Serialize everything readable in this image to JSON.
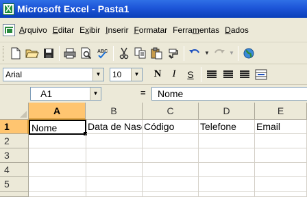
{
  "window": {
    "title": "Microsoft Excel - Pasta1"
  },
  "menu": [
    {
      "id": "arquivo",
      "label": "Arquivo"
    },
    {
      "id": "editar",
      "label": "Editar"
    },
    {
      "id": "exibir",
      "label": "Exibir"
    },
    {
      "id": "inserir",
      "label": "Inserir"
    },
    {
      "id": "formatar",
      "label": "Formatar"
    },
    {
      "id": "ferramentas",
      "label": "Ferramentas"
    },
    {
      "id": "dados",
      "label": "Dados"
    }
  ],
  "toolbar": {
    "icons": [
      "new-icon",
      "open-icon",
      "save-icon",
      "print-icon",
      "print-preview-icon",
      "spelling-icon",
      "cut-icon",
      "copy-icon",
      "paste-icon",
      "format-painter-icon",
      "undo-icon",
      "redo-icon",
      "web-icon"
    ]
  },
  "format": {
    "font": "Arial",
    "size": "10",
    "bold": "N",
    "italic": "I",
    "underline": "S"
  },
  "formula": {
    "name_box": "A1",
    "equals": "=",
    "content": "Nome"
  },
  "grid": {
    "columns": [
      "A",
      "B",
      "C",
      "D",
      "E"
    ],
    "rows": [
      "1",
      "2",
      "3",
      "4",
      "5"
    ],
    "cells": {
      "A1": "Nome",
      "B1": "Data de Nascimento",
      "C1": "Código",
      "D1": "Telefone",
      "E1": "Email"
    },
    "active_cell": "A1"
  },
  "colors": {
    "title_bar": "#1d55d8",
    "chrome": "#ece9d8",
    "active_header": "#ffc570"
  }
}
